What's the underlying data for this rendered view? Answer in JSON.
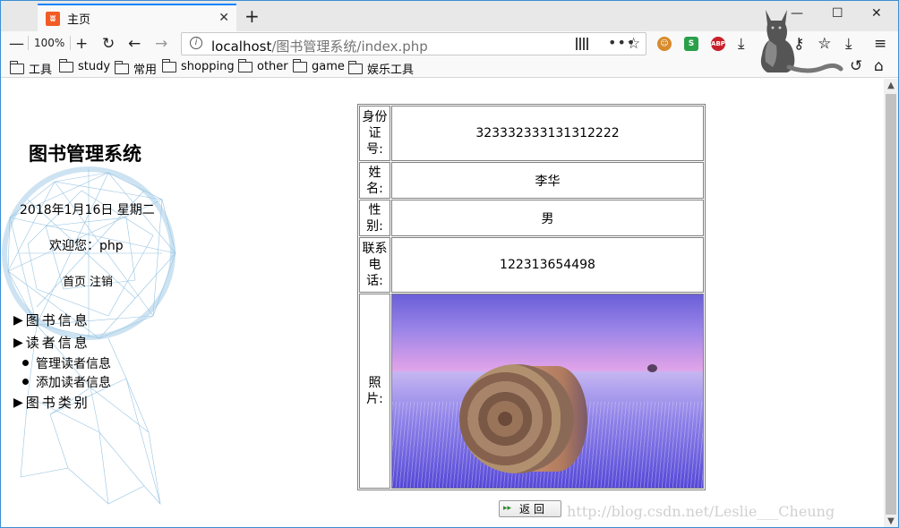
{
  "browser": {
    "tab": {
      "title": "主页"
    },
    "zoom": "100%",
    "url": {
      "host": "localhost",
      "path": "/图书管理系统/index.php"
    },
    "bookmarks": [
      "工具",
      "study",
      "常用",
      "shopping",
      "other",
      "game",
      "娱乐工具"
    ],
    "extensions": [
      {
        "name": "ext-monkey-icon",
        "label": "",
        "color": "#d88a2a"
      },
      {
        "name": "ext-s-icon",
        "label": "S",
        "color": "#2aa04a"
      },
      {
        "name": "ext-abp-icon",
        "label": "ABP",
        "color": "#c8202a"
      }
    ]
  },
  "sidebar": {
    "title": "图书管理系统",
    "date": "2018年1月16日 星期二",
    "welcome": "欢迎您：php",
    "links": {
      "home": "首页",
      "logout": "注销"
    },
    "menu": [
      {
        "label": "图书信息",
        "subs": []
      },
      {
        "label": "读者信息",
        "subs": [
          "管理读者信息",
          "添加读者信息"
        ]
      },
      {
        "label": "图书类别",
        "subs": []
      }
    ]
  },
  "reader": {
    "id_label": "身份证号:",
    "id_value": "323332333131312222",
    "name_label": "姓名:",
    "name_value": "李华",
    "gender_label": "性别:",
    "gender_value": "男",
    "phone_label": "联系电话:",
    "phone_value": "122313654498",
    "photo_label": "照片:"
  },
  "back_button": "返回",
  "watermark": "http://blog.csdn.net/Leslie___Cheung"
}
